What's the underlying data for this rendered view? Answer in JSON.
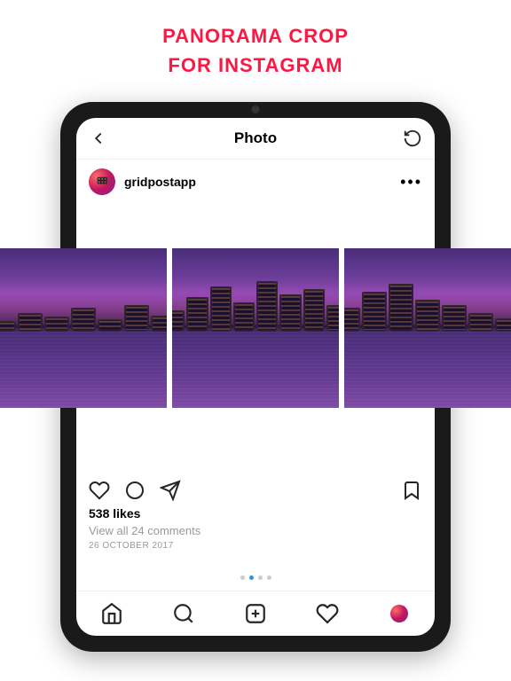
{
  "promo": {
    "line1": "PANORAMA CROP",
    "line2": "FOR INSTAGRAM"
  },
  "header": {
    "title": "Photo"
  },
  "post": {
    "username": "gridpostapp",
    "likes": "538 likes",
    "comments_link": "View all 24 comments",
    "date": "26 OCTOBER 2017"
  }
}
